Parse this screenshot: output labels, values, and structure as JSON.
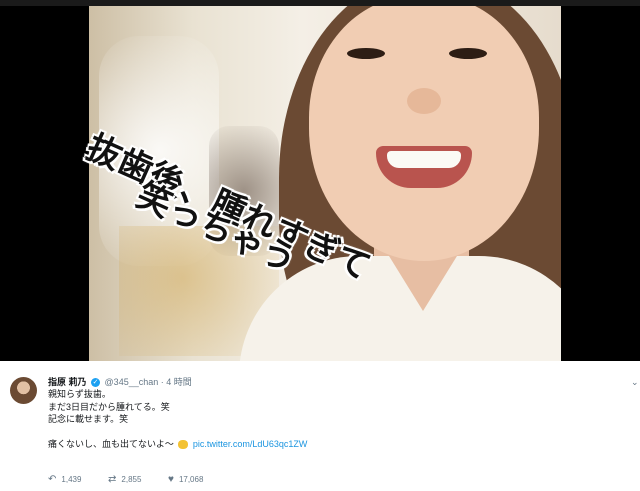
{
  "media": {
    "caption_line1": "抜歯後、腫れすぎて",
    "caption_line2": "笑っちゃう"
  },
  "tweet": {
    "display_name": "指原 莉乃",
    "handle": "@345__chan",
    "separator": "·",
    "time": "4 時間",
    "lines": [
      "親知らず抜歯。",
      "まだ3日目だから腫れてる。笑",
      "記念に載せます。笑"
    ],
    "last_line_text": "痛くないし、血も出てないよ〜",
    "link": "pic.twitter.com/LdU63qc1ZW",
    "actions": {
      "reply_count": "1,439",
      "retweet_count": "2,855",
      "like_count": "17,068"
    }
  },
  "icons": [
    "verified-badge-icon",
    "reply-icon",
    "retweet-icon",
    "like-icon",
    "caret-down-icon",
    "clap-emoji-icon"
  ],
  "colors": {
    "link": "#1b95e0",
    "verified": "#1da1f2",
    "secondary_text": "#657786"
  }
}
